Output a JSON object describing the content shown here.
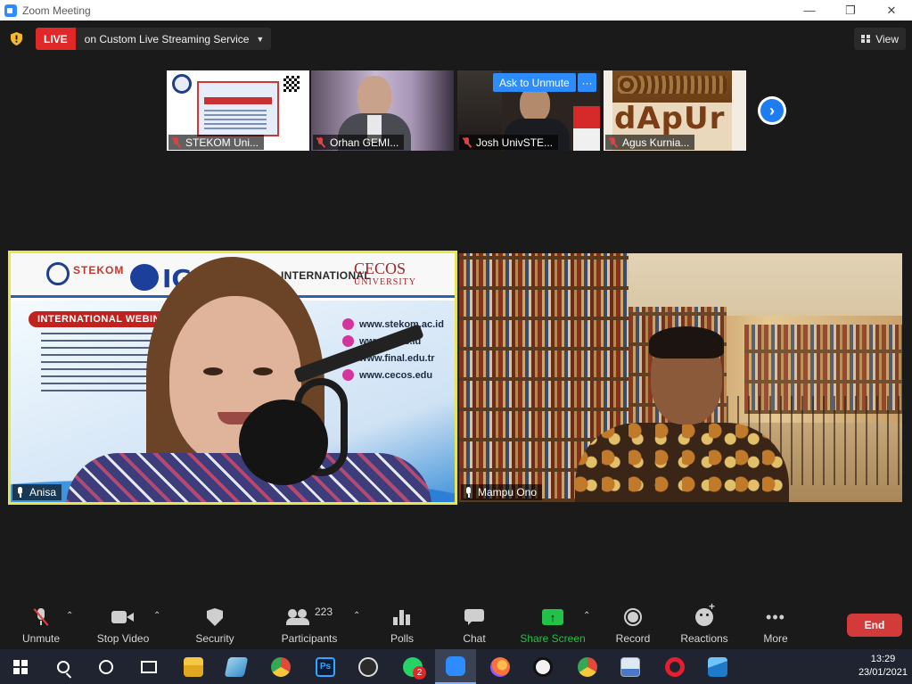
{
  "window": {
    "title": "Zoom Meeting",
    "minimize": "—",
    "restore": "❐",
    "close": "✕"
  },
  "topbar": {
    "live_badge": "LIVE",
    "live_text": "on Custom Live Streaming Service",
    "live_caret": "▼",
    "view_label": "View"
  },
  "thumbnails": [
    {
      "name": "STEKOM Uni...",
      "muted": true
    },
    {
      "name": "Orhan GEMI...",
      "muted": true
    },
    {
      "name": "Josh UnivSTE...",
      "muted": true
    },
    {
      "name": "Agus Kurnia...",
      "muted": true
    }
  ],
  "thumbnail_actions": {
    "ask_to_unmute": "Ask to Unmute",
    "more": "···",
    "next_page": "›"
  },
  "thumbnail_content": {
    "dapur_text": "dApUr"
  },
  "speakers": {
    "left": {
      "name": "Anisa",
      "poster": {
        "university": "STEKOM",
        "igi": "IGI",
        "intl": "INTERNATIONAL",
        "intl_sub": "SITY",
        "cecos": "CECOS",
        "cecos_sub": "UNIVERSITY",
        "webinar": "INTERNATIONAL WEBINAR",
        "urls": [
          "www.stekom.ac.id",
          "www.igi.ac.id",
          "www.final.edu.tr",
          "www.cecos.edu"
        ]
      }
    },
    "right": {
      "name": "Mampu Ono"
    }
  },
  "toolbar": {
    "unmute": "Unmute",
    "stop_video": "Stop Video",
    "security": "Security",
    "participants": "Participants",
    "participant_count": "223",
    "polls": "Polls",
    "chat": "Chat",
    "share_screen": "Share Screen",
    "record": "Record",
    "reactions": "Reactions",
    "more": "More",
    "end": "End",
    "caret": "⌃"
  },
  "taskbar": {
    "whatsapp_badge": "2",
    "time": "13:29",
    "date": "23/01/2021"
  },
  "colors": {
    "live_red": "#e02828",
    "zoom_blue": "#2d8cff",
    "share_green": "#23c04a",
    "end_red": "#d33a3a",
    "active_speaker_border": "#e8e64a"
  }
}
